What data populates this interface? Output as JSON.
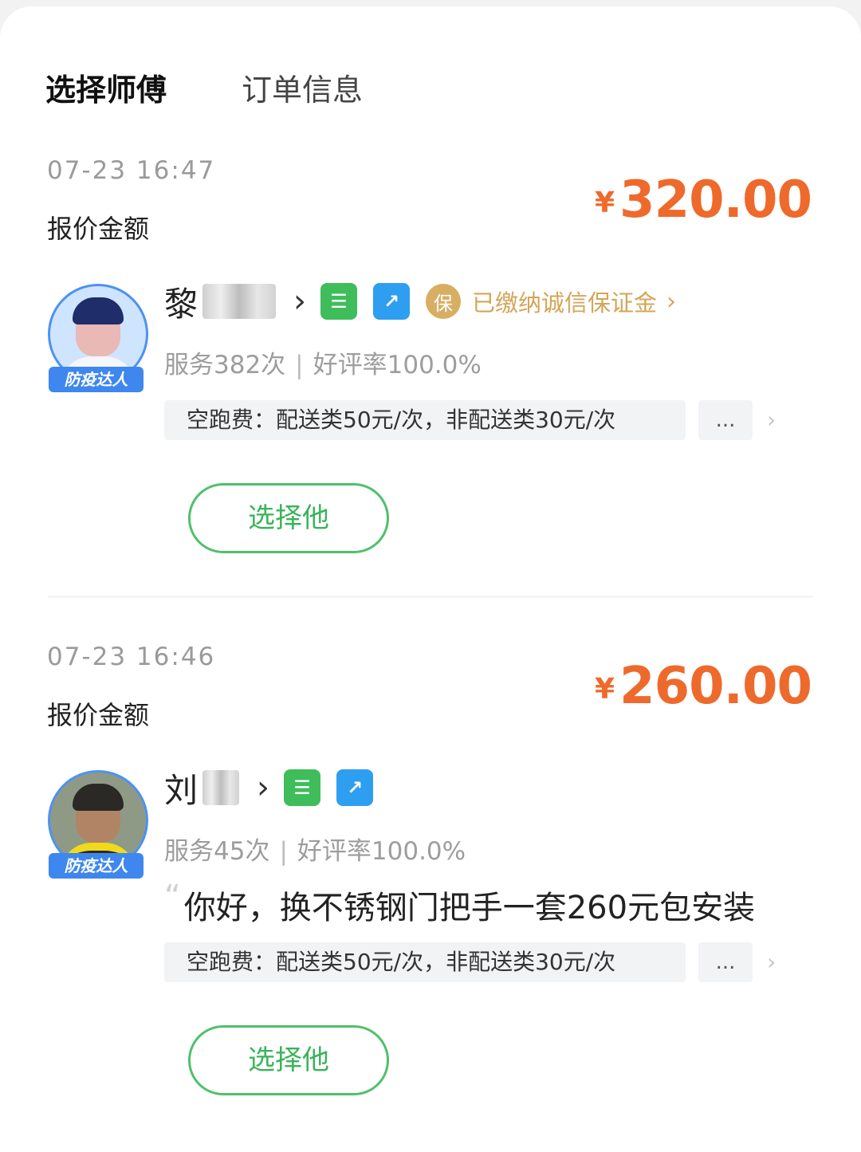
{
  "tabs": [
    {
      "label": "选择师傅"
    },
    {
      "label": "订单信息"
    }
  ],
  "quotes": [
    {
      "time": "07-23 16:47",
      "price_label": "报价金额",
      "currency": "¥",
      "amount": "320.00",
      "name": "黎",
      "badge": "防疫达人",
      "deposit": "已缴纳诚信保证金",
      "bao": "保",
      "services": "服务382次",
      "rating": "好评率100.0%",
      "fee": "空跑费：配送类50元/次，非配送类30元/次",
      "more": "...",
      "select": "选择他"
    },
    {
      "time": "07-23 16:46",
      "price_label": "报价金额",
      "currency": "¥",
      "amount": "260.00",
      "name": "刘",
      "badge": "防疫达人",
      "services": "服务45次",
      "rating": "好评率100.0%",
      "message": "你好，换不锈钢门把手一套260元包安装",
      "fee": "空跑费：配送类50元/次，非配送类30元/次",
      "more": "...",
      "select": "选择他"
    }
  ],
  "colors": {
    "price": "#ee6a2c",
    "accent_green": "#39b35a",
    "deposit_gold": "#d4a558",
    "badge_blue": "#3e87ee"
  },
  "icons": {
    "green_icon": "certificate-icon",
    "blue_icon": "syringe-icon",
    "gold_icon": "guarantee-icon"
  }
}
